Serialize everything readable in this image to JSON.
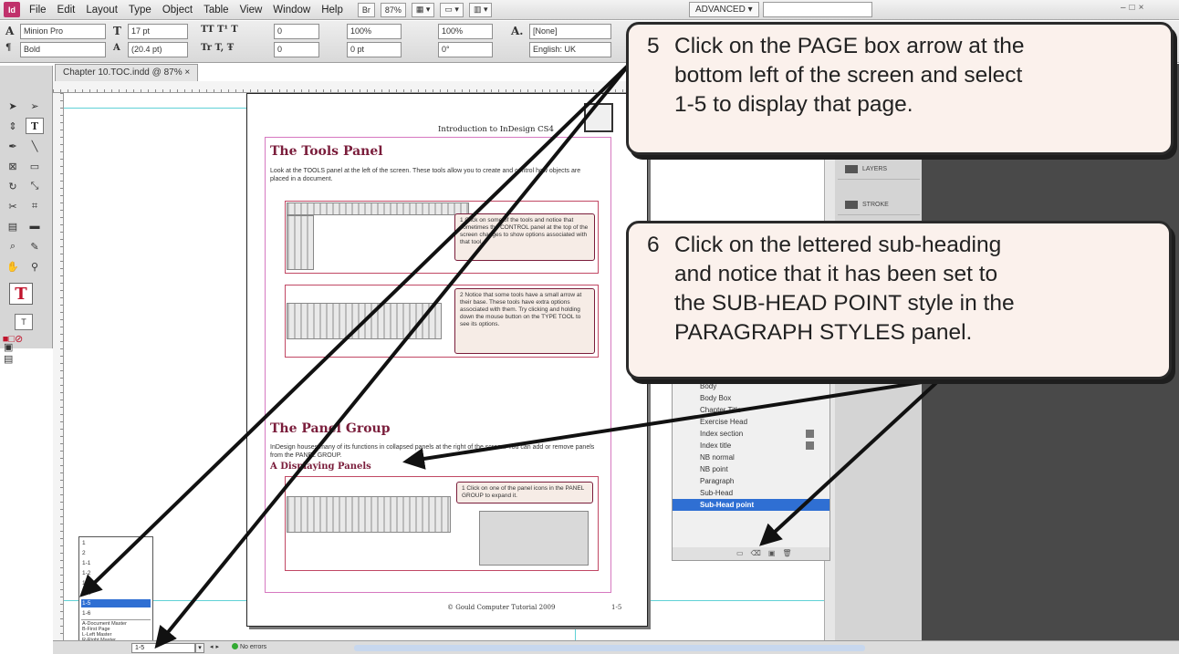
{
  "menu": {
    "items": [
      "File",
      "Edit",
      "Layout",
      "Type",
      "Object",
      "Table",
      "View",
      "Window",
      "Help"
    ],
    "zoom": "87%",
    "workspace": "ADVANCED"
  },
  "control": {
    "font_family": "Minion Pro",
    "font_style": "Bold",
    "font_size": "17 pt",
    "leading": "(20.4 pt)",
    "tracking_kerning": "0",
    "scale_v": "100%",
    "scale_h": "100%",
    "baseline": "0 pt",
    "skew": "0°",
    "char_style": "[None]",
    "language": "English: UK"
  },
  "document_tab": "Chapter 10.TOC.indd @ 87%",
  "page": {
    "running_head": "Introduction to InDesign CS4",
    "section1_title": "The Tools Panel",
    "section1_body": "Look at the TOOLS panel at the left of the screen. These tools allow you to create and control how objects are placed in a document.",
    "mini_callout_1": "1  Click on some of the tools and notice that sometimes the CONTROL panel at the top of the screen changes to show options associated with that tool.",
    "mini_callout_2": "2  Notice that some tools have a small arrow at their base. These tools have extra options associated with them. Try clicking and holding down the mouse button on the TYPE TOOL to see its options.",
    "section2_title": "The Panel Group",
    "section2_body": "InDesign houses many of its functions in collapsed panels at the right of the screen. You can add or remove panels from the PANEL GROUP.",
    "subheading": "A   Displaying Panels",
    "mini_callout_3": "1  Click on one of the panel icons in the PANEL GROUP to expand it.",
    "footer": "© Gould Computer Tutorial 2009",
    "footer_page": "1-5"
  },
  "panels": {
    "layers": "LAYERS",
    "stroke": "STROKE"
  },
  "paragraph_styles": {
    "items": [
      "Body",
      "Body Box",
      "Chapter Title",
      "Exercise Head",
      "Index section",
      "Index title",
      "NB normal",
      "NB point",
      "Paragraph",
      "Sub-Head",
      "Sub-Head point"
    ],
    "selected": "Sub-Head point"
  },
  "page_dropdown": {
    "items": [
      "1",
      "2",
      "1-1",
      "1-2",
      "1-3",
      "1-4",
      "1-5",
      "1-6"
    ],
    "masters": [
      "A-Document Master",
      "B-First Page",
      "L-Left Master",
      "R-Right Master"
    ],
    "selected": "1-5"
  },
  "status": {
    "page_box": "1-5",
    "preflight": "No errors"
  },
  "callouts": {
    "c5": {
      "num": "5",
      "text": "Click on the PAGE box arrow at the\nbottom left of the screen and select\n1-5 to display that page."
    },
    "c6": {
      "num": "6",
      "text": "Click on the lettered sub-heading\nand notice that it has been set to\nthe SUB-HEAD POINT style in the\nPARAGRAPH STYLES panel."
    }
  },
  "colors": {
    "selection": "#2f6fd3",
    "heading": "#7a1d3b",
    "callout_bg": "#fbf1ec"
  }
}
